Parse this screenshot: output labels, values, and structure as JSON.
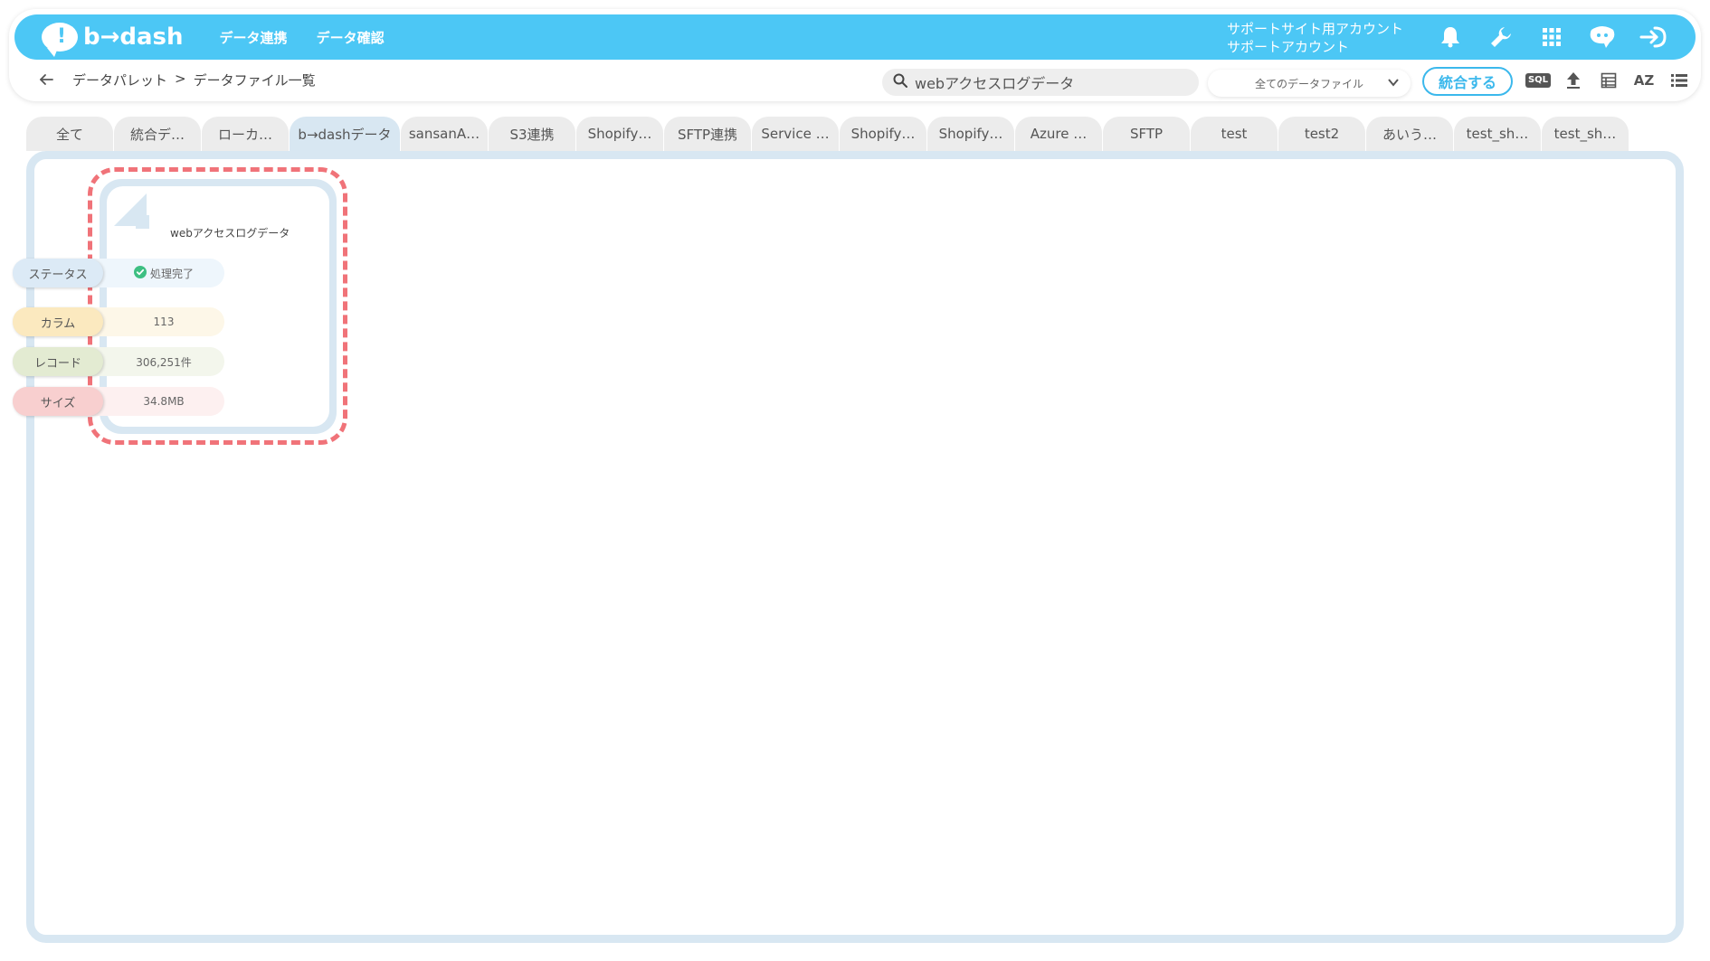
{
  "header": {
    "logo_text": "b→dash",
    "nav": [
      "データ連携",
      "データ確認"
    ],
    "account_line1": "サポートサイト用アカウント",
    "account_line2": "サポートアカウント",
    "icons": [
      "bell-icon",
      "wrench-icon",
      "grid-icon",
      "support-chat-icon",
      "logout-icon"
    ]
  },
  "subbar": {
    "breadcrumb_parent": "データパレット",
    "breadcrumb_separator": ">",
    "breadcrumb_current": "データファイル一覧",
    "search_value": "webアクセスログデータ",
    "filter_selected": "全てのデータファイル",
    "merge_label": "統合する",
    "sql_label": "SQL",
    "sort_label": "AZ"
  },
  "tabs": [
    {
      "label": "全て"
    },
    {
      "label": "統合デ…"
    },
    {
      "label": "ローカ…"
    },
    {
      "label": "b→dashデータ",
      "active": true
    },
    {
      "label": "sansanA…"
    },
    {
      "label": "S3連携"
    },
    {
      "label": "Shopify…"
    },
    {
      "label": "SFTP連携"
    },
    {
      "label": "Service …"
    },
    {
      "label": "Shopify…"
    },
    {
      "label": "Shopify…"
    },
    {
      "label": "Azure …"
    },
    {
      "label": "SFTP"
    },
    {
      "label": "test"
    },
    {
      "label": "test2"
    },
    {
      "label": "あいう…"
    },
    {
      "label": "test_sh…"
    },
    {
      "label": "test_sh…"
    }
  ],
  "card": {
    "title": "webアクセスログデータ",
    "status_label": "ステータス",
    "status_value": "処理完了",
    "column_label": "カラム",
    "column_value": "113",
    "record_label": "レコード",
    "record_value": "306,251件",
    "size_label": "サイズ",
    "size_value": "34.8MB"
  },
  "colors": {
    "brand": "#4cc7f5",
    "accent": "#3bb8ec",
    "highlight": "#f07379",
    "status_ok": "#3dbf82"
  }
}
